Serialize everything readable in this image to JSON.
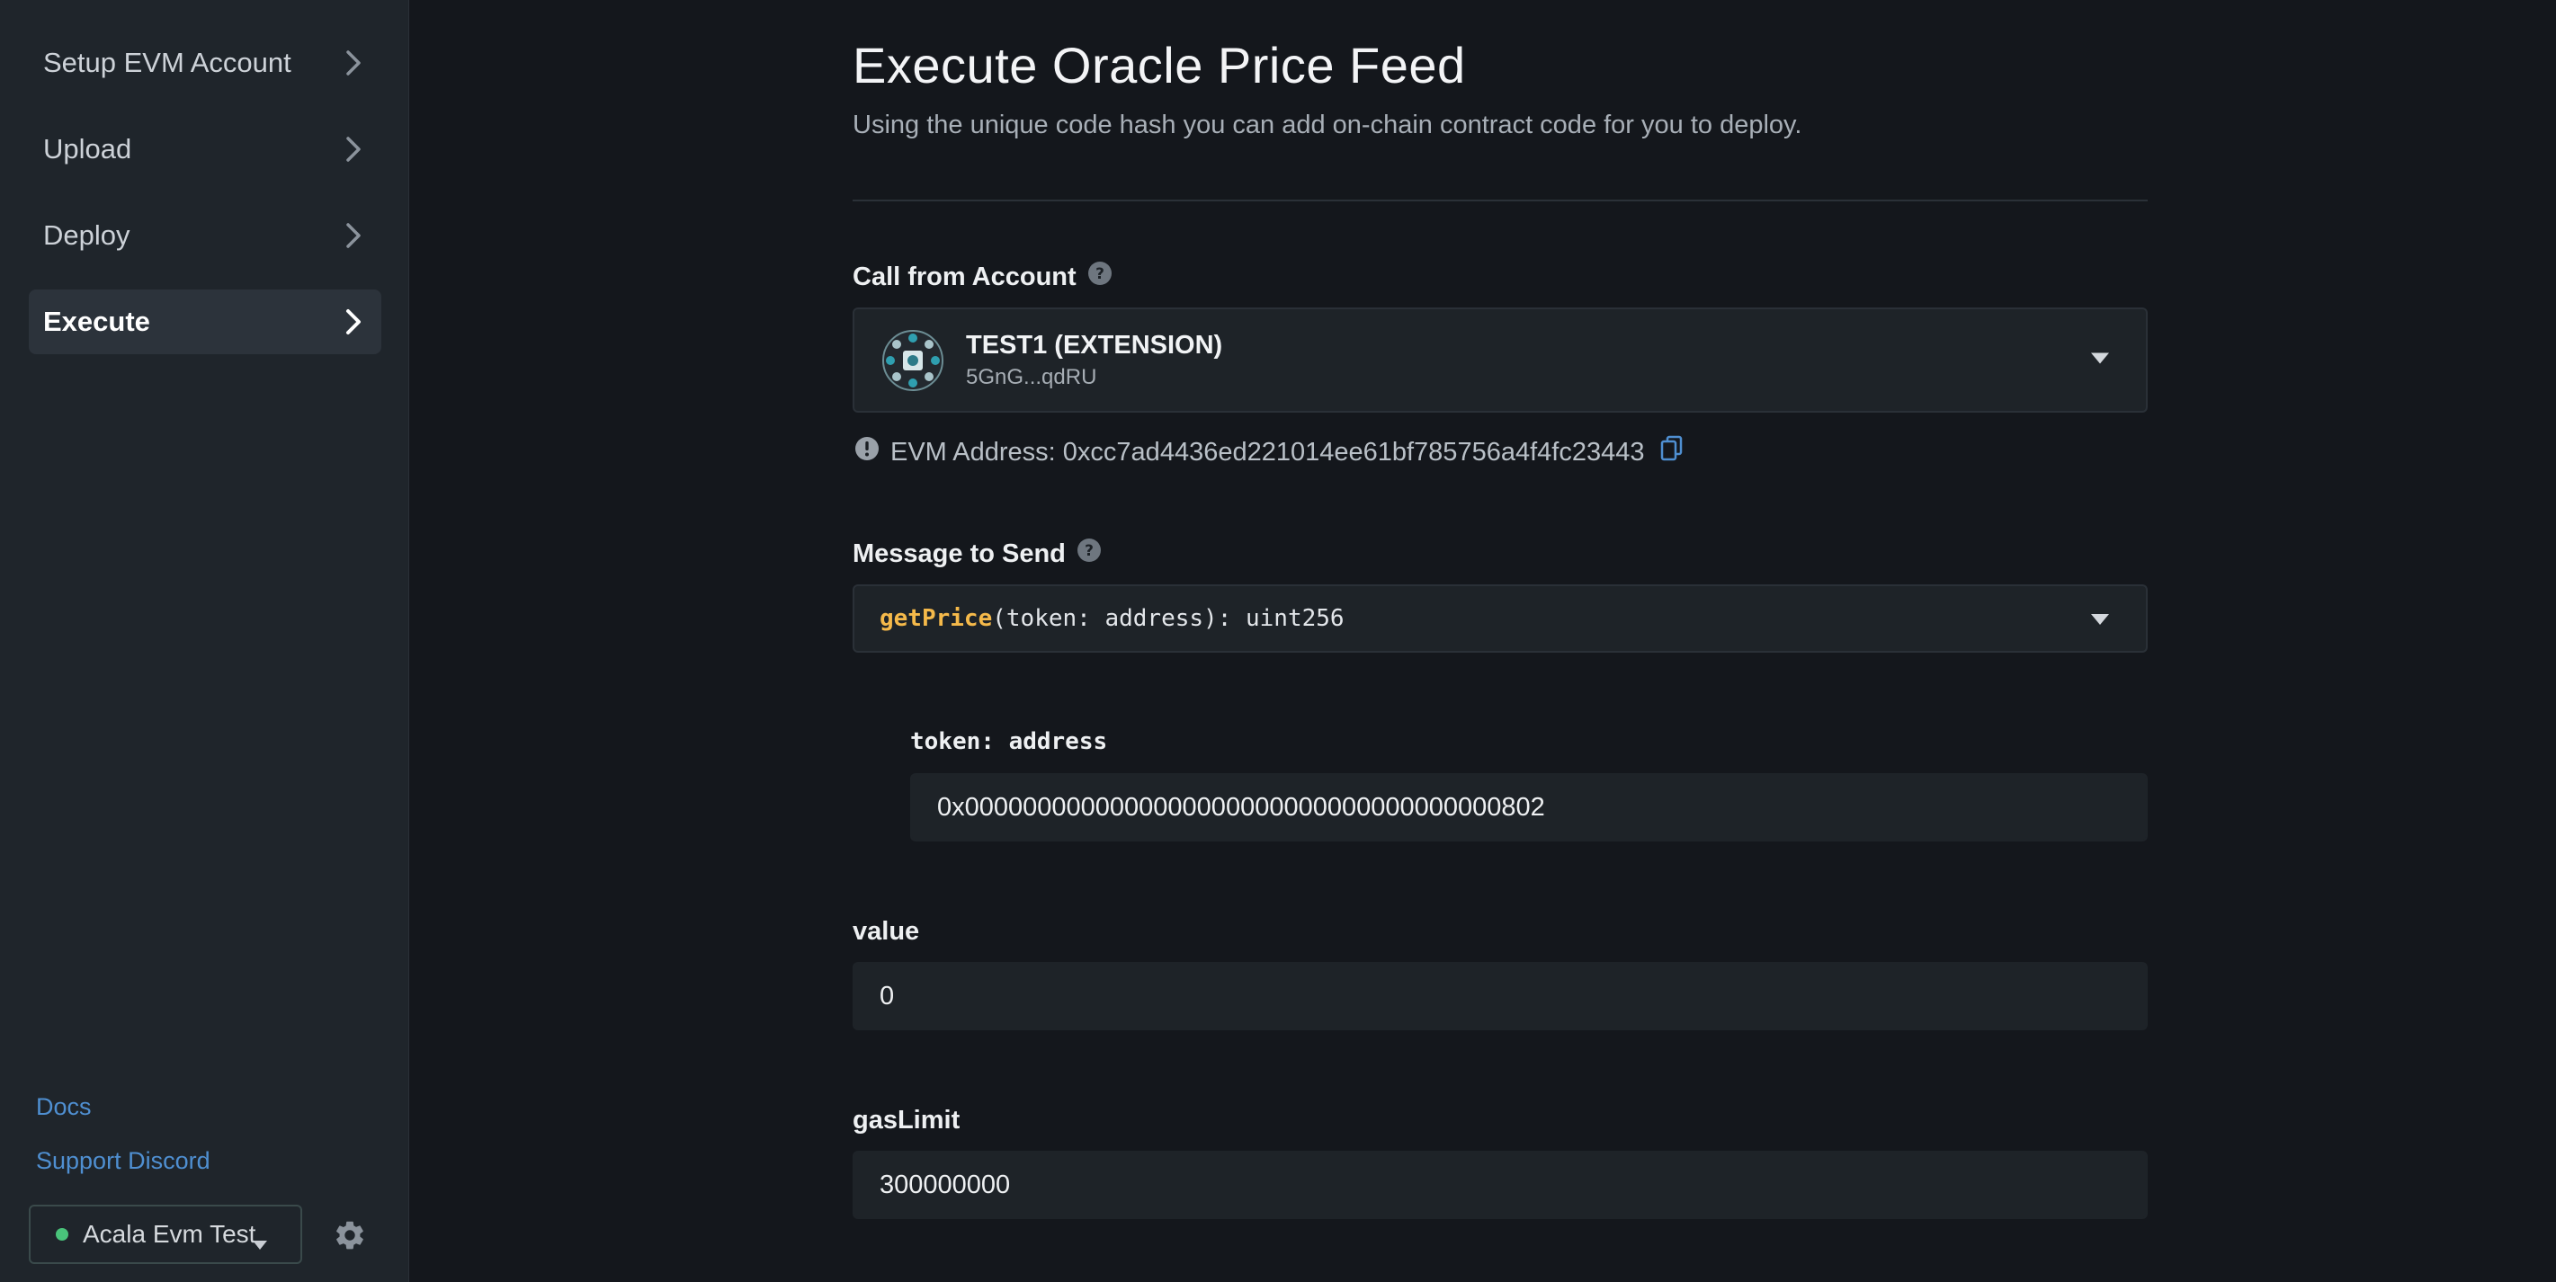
{
  "sidebar": {
    "items": [
      {
        "label": "Setup EVM Account",
        "icon": "chevron-right-icon",
        "active": false
      },
      {
        "label": "Upload",
        "icon": "chevron-right-icon",
        "active": false
      },
      {
        "label": "Deploy",
        "icon": "chevron-right-icon",
        "active": false
      },
      {
        "label": "Execute",
        "icon": "chevron-right-icon",
        "active": true
      }
    ],
    "links": {
      "docs": "Docs",
      "support": "Support Discord"
    },
    "network": {
      "label": "Acala Evm Test",
      "status_color": "#49c37a"
    },
    "settings_icon": "gear-icon"
  },
  "main": {
    "title": "Execute Oracle Price Feed",
    "subtitle": "Using the unique code hash you can add on-chain contract code for you to deploy.",
    "call_from": {
      "label": "Call from Account",
      "account_name": "TEST1 (EXTENSION)",
      "account_address": "5GnG...qdRU",
      "evm_address_text": "EVM Address: 0xcc7ad4436ed221014ee61bf785756a4f4fc23443"
    },
    "message": {
      "label": "Message to Send",
      "fn_name": "getPrice",
      "fn_signature": "(token: address): uint256"
    },
    "params": {
      "token_label": "token: address",
      "token_value": "0x0000000000000000000000000000000000000802"
    },
    "value": {
      "label": "value",
      "input": "0"
    },
    "gas_limit": {
      "label": "gasLimit",
      "input": "300000000"
    }
  },
  "colors": {
    "background": "#14171c",
    "sidebar": "#1f252b",
    "link": "#4f8fd1",
    "function_name": "#f5b94a",
    "status_dot": "#49c37a"
  }
}
